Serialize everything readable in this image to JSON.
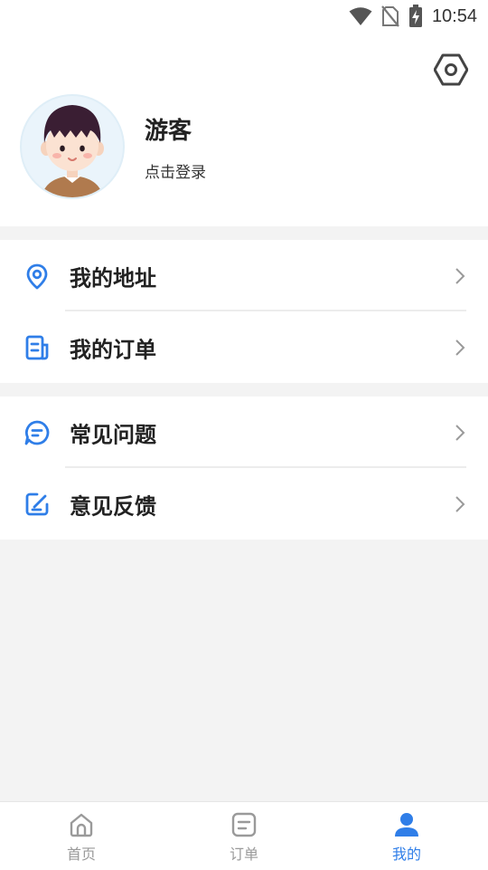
{
  "status_bar": {
    "time": "10:54",
    "icons": [
      "wifi-icon",
      "no-sim-icon",
      "battery-charging-icon"
    ]
  },
  "settings": {
    "icon": "settings-hexagon-icon"
  },
  "profile": {
    "avatar_icon": "cartoon-boy-avatar",
    "user_name": "游客",
    "login_text": "点击登录"
  },
  "menu": {
    "group1": [
      {
        "label": "我的地址",
        "icon": "location-pin-icon"
      },
      {
        "label": "我的订单",
        "icon": "order-document-icon"
      }
    ],
    "group2": [
      {
        "label": "常见问题",
        "icon": "faq-chat-icon"
      },
      {
        "label": "意见反馈",
        "icon": "feedback-edit-icon"
      }
    ]
  },
  "tab_bar": {
    "tabs": [
      {
        "label": "首页",
        "icon": "home-icon",
        "active": false
      },
      {
        "label": "订单",
        "icon": "orders-icon",
        "active": false
      },
      {
        "label": "我的",
        "icon": "profile-person-icon",
        "active": true
      }
    ]
  },
  "colors": {
    "accent": "#2f7ee8",
    "inactive": "#9a9a9a",
    "background": "#f3f3f3"
  }
}
